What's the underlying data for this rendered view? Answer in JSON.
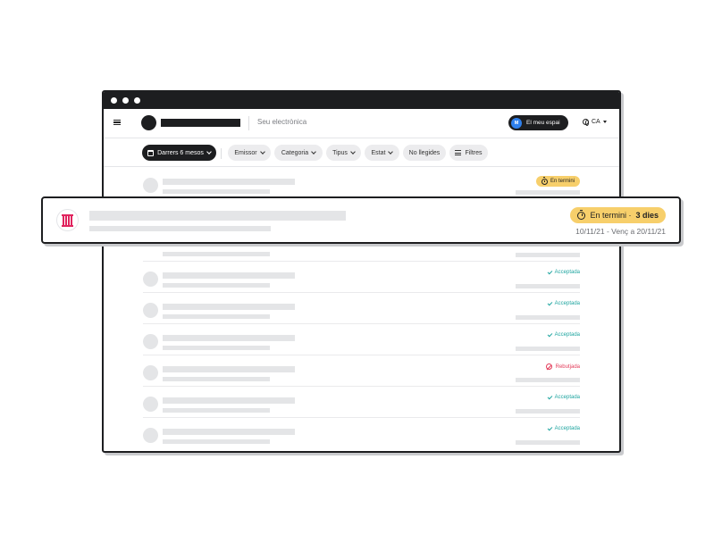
{
  "header": {
    "subtitle": "Seu electrònica",
    "space_button": "El meu espai",
    "avatar_initial": "M",
    "language": "CA"
  },
  "filters": [
    {
      "label": "Darrers 6 mesos",
      "has_dropdown": true,
      "active": true,
      "icon": "calendar-icon"
    },
    {
      "label": "Emissor",
      "has_dropdown": true
    },
    {
      "label": "Categoria",
      "has_dropdown": true
    },
    {
      "label": "Tipus",
      "has_dropdown": true
    },
    {
      "label": "Estat",
      "has_dropdown": true
    },
    {
      "label": "No llegides",
      "has_dropdown": false
    },
    {
      "label": "Filtres",
      "has_dropdown": false,
      "icon": "sliders-icon"
    }
  ],
  "rows": [
    {
      "status": "En termini",
      "status_type": "pending"
    },
    {
      "status": "",
      "status_type": "hidden"
    },
    {
      "status": "",
      "status_type": "hidden"
    },
    {
      "status": "Acceptada",
      "status_type": "accepted"
    },
    {
      "status": "Acceptada",
      "status_type": "accepted"
    },
    {
      "status": "Acceptada",
      "status_type": "accepted"
    },
    {
      "status": "Rebutjada",
      "status_type": "rejected"
    },
    {
      "status": "Acceptada",
      "status_type": "accepted"
    },
    {
      "status": "Acceptada",
      "status_type": "accepted"
    }
  ],
  "highlight": {
    "status_prefix": "En termini · ",
    "status_days": "3 dies",
    "dates": "10/11/21 - Venç a 20/11/21",
    "issuer_icon": "generalitat-seal-icon"
  },
  "colors": {
    "dark": "#1d1e20",
    "pending_badge": "#f7cf6b",
    "accepted": "#1fa5a0",
    "rejected": "#e33c5a",
    "avatar": "#2f80ed",
    "issuer_logo": "#e0245e"
  }
}
